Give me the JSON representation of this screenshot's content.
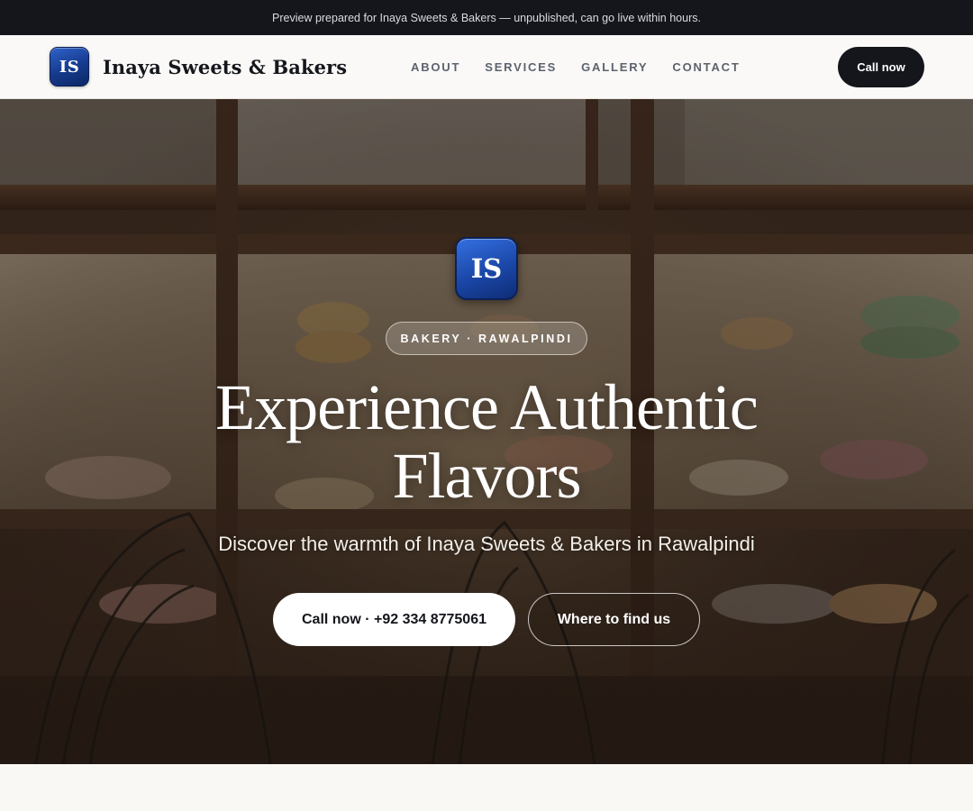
{
  "preview_banner": {
    "text": "Preview prepared for Inaya Sweets & Bakers — unpublished, can go live within hours."
  },
  "header": {
    "logo_initials": "IS",
    "brand_name": "Inaya Sweets & Bakers",
    "nav": {
      "about": "ABOUT",
      "services": "SERVICES",
      "gallery": "GALLERY",
      "contact": "CONTACT"
    },
    "call_button": "Call now"
  },
  "hero": {
    "logo_initials": "IS",
    "category_pill": "BAKERY · RAWALPINDI",
    "title": "Experience Authentic Flavors",
    "subtitle": "Discover the warmth of Inaya Sweets & Bakers in Rawalpindi",
    "primary_button": "Call now · +92 334 8775061",
    "secondary_button": "Where to find us",
    "background_image": "bakery-window-photo"
  },
  "colors": {
    "banner_bg": "#14161c",
    "header_bg": "#faf9f7",
    "logo_blue": "#1a47a8",
    "nav_text": "#5c626d",
    "dark_button": "#14161c"
  }
}
